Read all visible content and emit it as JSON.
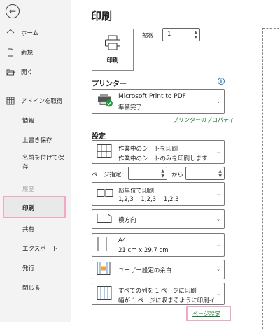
{
  "nav": {
    "items": [
      {
        "label": "ホーム",
        "icon": "home-icon"
      },
      {
        "label": "新規",
        "icon": "new-file-icon"
      },
      {
        "label": "開く",
        "icon": "open-folder-icon"
      },
      {
        "label": "アドインを取得",
        "icon": "addins-grid-icon"
      },
      {
        "label": "情報"
      },
      {
        "label": "上書き保存"
      },
      {
        "label": "名前を付けて保\n存"
      },
      {
        "label": "履歴"
      },
      {
        "label": "印刷"
      },
      {
        "label": "共有"
      },
      {
        "label": "エクスポート"
      },
      {
        "label": "発行"
      },
      {
        "label": "閉じる"
      }
    ]
  },
  "main": {
    "title": "印刷",
    "print_button": "印刷",
    "copies_label": "部数:",
    "copies_value": "1",
    "printer_heading": "プリンター",
    "printer_name": "Microsoft Print to PDF",
    "printer_status": "準備完了",
    "printer_props_link": "プリンターのプロパティ",
    "settings_heading": "設定",
    "settings": [
      {
        "line1": "作業中のシートを印刷",
        "line2": "作業中のシートのみを印刷します"
      },
      {
        "line1": "部単位で印刷",
        "line2": "1,2,3    1,2,3    1,2,3"
      },
      {
        "line1": "横方向",
        "line2": ""
      },
      {
        "line1": "A4",
        "line2": "21 cm x 29.7 cm"
      },
      {
        "line1": "ユーザー設定の余白",
        "line2": ""
      },
      {
        "line1": "すべての列を 1 ページに印刷",
        "line2": "幅が 1 ページに収まるように印刷イ..."
      }
    ],
    "pages_label": "ページ指定:",
    "pages_to": "から",
    "page_setup_link": "ページ設定"
  },
  "colors": {
    "highlight": "#f2a7c8",
    "link": "#1a7a3a",
    "info": "#2b78c2",
    "printer_ok": "#1f9d3a"
  }
}
